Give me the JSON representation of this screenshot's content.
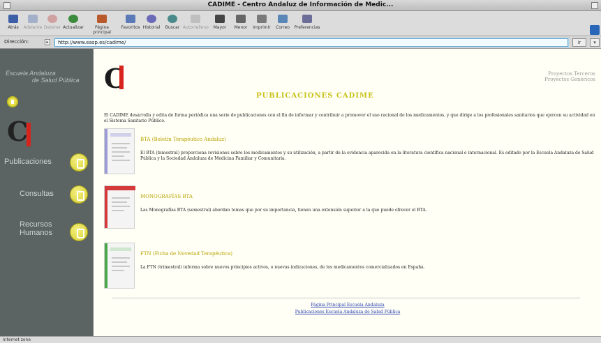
{
  "window": {
    "title": "CADIME - Centro Andaluz de Información de Medic..."
  },
  "toolbar": {
    "buttons": [
      {
        "label": "Atrás",
        "icon": "back-arrow-icon",
        "enabled": true
      },
      {
        "label": "Adelante",
        "icon": "forward-arrow-icon",
        "enabled": false
      },
      {
        "label": "Detener",
        "icon": "stop-icon",
        "enabled": false
      },
      {
        "label": "Actualizar",
        "icon": "refresh-icon",
        "enabled": true
      },
      {
        "label": "Página principal",
        "icon": "home-icon",
        "enabled": true
      },
      {
        "label": "Favoritos",
        "icon": "favorites-icon",
        "enabled": true
      },
      {
        "label": "Historial",
        "icon": "history-icon",
        "enabled": true
      },
      {
        "label": "Buscar",
        "icon": "search-icon",
        "enabled": true
      },
      {
        "label": "Autorrelleno",
        "icon": "autofill-icon",
        "enabled": false
      },
      {
        "label": "Mayor",
        "icon": "larger-text-icon",
        "enabled": true
      },
      {
        "label": "Menor",
        "icon": "smaller-text-icon",
        "enabled": true
      },
      {
        "label": "Imprimir",
        "icon": "print-icon",
        "enabled": true
      },
      {
        "label": "Correo",
        "icon": "mail-icon",
        "enabled": true
      },
      {
        "label": "Preferencias",
        "icon": "preferences-icon",
        "enabled": true
      }
    ]
  },
  "address": {
    "label": "Dirección:",
    "value": "http://www.easp.es/cadime/",
    "go_label": "ir",
    "extra_label": "▾"
  },
  "sidebar": {
    "school_line1": "Escuela Andaluza",
    "school_line2": "de Salud Pública",
    "logo_text": "C",
    "nav": [
      {
        "label": "Publicaciones"
      },
      {
        "label": "Consultas"
      },
      {
        "label": "Recursos Humanos"
      }
    ]
  },
  "content": {
    "logo_text": "C",
    "corner_line1": "Proyectos Terceros",
    "corner_line2": "Proyectos Genéricos",
    "page_title": "PUBLICACIONES CADIME",
    "intro": "El CADIME desarrolla y edita de forma periódica una serie de publicaciones con el fin de informar y contribuir a promover el uso racional de los medicamentos, y que dirige a los profesionales sanitarios que ejercen su actividad en el Sistema Sanitario Público.",
    "publications": [
      {
        "title": "BTA (Boletín Terapéutico Andaluz)",
        "desc": "El BTA (bimestral) proporciona revisiones sobre los medicamentos y su utilización, a partir de la evidencia aparecida en la literatura científica nacional e internacional. Es editado por la Escuela Andaluza de Salud Pública y la Sociedad Andaluza de Medicina Familiar y Comunitaria.",
        "accent": "#9b9bd6"
      },
      {
        "title": "MONOGRAFÍAS BTA",
        "desc": "Las Monografías BTA (semestral) abordan temas que por su importancia, tienen una extensión superior a la que puede ofrecer el BTA.",
        "accent": "#d43a3a"
      },
      {
        "title": "FTN (Ficha de Novedad Terapéutica)",
        "desc": "La FTN (trimestral) informa sobre nuevos principios activos, o nuevas indicaciones, de los medicamentos comercializados en España.",
        "accent": "#4aa84a"
      }
    ],
    "footer_link1": "Página Principal Escuela Andaluza",
    "footer_link2": "Publicaciones Escuela Andaluza de Salud Pública"
  },
  "status": {
    "text": "Internet zone"
  }
}
